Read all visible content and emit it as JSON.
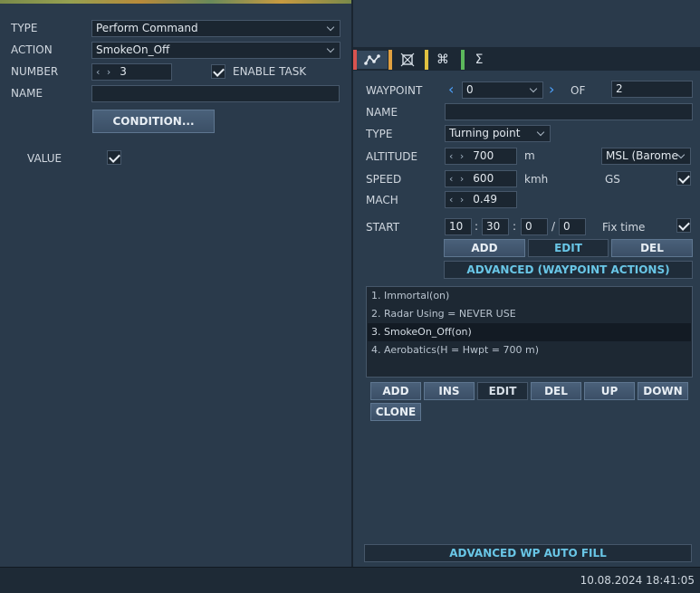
{
  "left": {
    "type_label": "TYPE",
    "type_value": "Perform Command",
    "action_label": "ACTION",
    "action_value": "SmokeOn_Off",
    "number_label": "NUMBER",
    "number_value": "3",
    "enable_task_label": "ENABLE TASK",
    "enable_task_checked": true,
    "name_label": "NAME",
    "name_value": "",
    "condition_button": "CONDITION...",
    "value_label": "VALUE",
    "value_checked": true
  },
  "tabs": [
    {
      "icon": "route-icon",
      "glyph": "⩘",
      "color": "#d9534f"
    },
    {
      "icon": "target-icon",
      "glyph": "⌖",
      "color": "#e0a040"
    },
    {
      "icon": "command-icon",
      "glyph": "⌘",
      "color": "#e0c040"
    },
    {
      "icon": "sigma-icon",
      "glyph": "Σ",
      "color": "#5cb85c"
    }
  ],
  "waypoint": {
    "label": "WAYPOINT",
    "value": "0",
    "of_label": "OF",
    "total": "2",
    "name_label": "NAME",
    "name_value": "",
    "type_label": "TYPE",
    "type_value": "Turning point",
    "altitude_label": "ALTITUDE",
    "altitude_value": "700",
    "altitude_unit": "m",
    "altitude_ref": "MSL (Barome",
    "speed_label": "SPEED",
    "speed_value": "600",
    "speed_unit": "kmh",
    "gs_label": "GS",
    "gs_checked": true,
    "mach_label": "MACH",
    "mach_value": "0.49",
    "start_label": "START",
    "start_h": "10",
    "start_m": "30",
    "start_s": "0",
    "start_d": "0",
    "sep_colon": ":",
    "sep_slash": "/",
    "fix_time_label": "Fix time",
    "fix_time_checked": true,
    "add_button": "ADD",
    "edit_button": "EDIT",
    "del_button": "DEL",
    "advanced_button": "ADVANCED (WAYPOINT ACTIONS)"
  },
  "actions": {
    "items": [
      "1. Immortal(on)",
      "2. Radar Using = NEVER USE",
      "3. SmokeOn_Off(on)",
      "4. Aerobatics(H = Hwpt = 700 m)"
    ],
    "selected_index": 2,
    "add_button": "ADD",
    "ins_button": "INS",
    "edit_button": "EDIT",
    "del_button": "DEL",
    "up_button": "UP",
    "down_button": "DOWN",
    "clone_button": "CLONE"
  },
  "auto_fill_button": "ADVANCED WP AUTO FILL",
  "status": {
    "datetime": "10.08.2024 18:41:05"
  }
}
